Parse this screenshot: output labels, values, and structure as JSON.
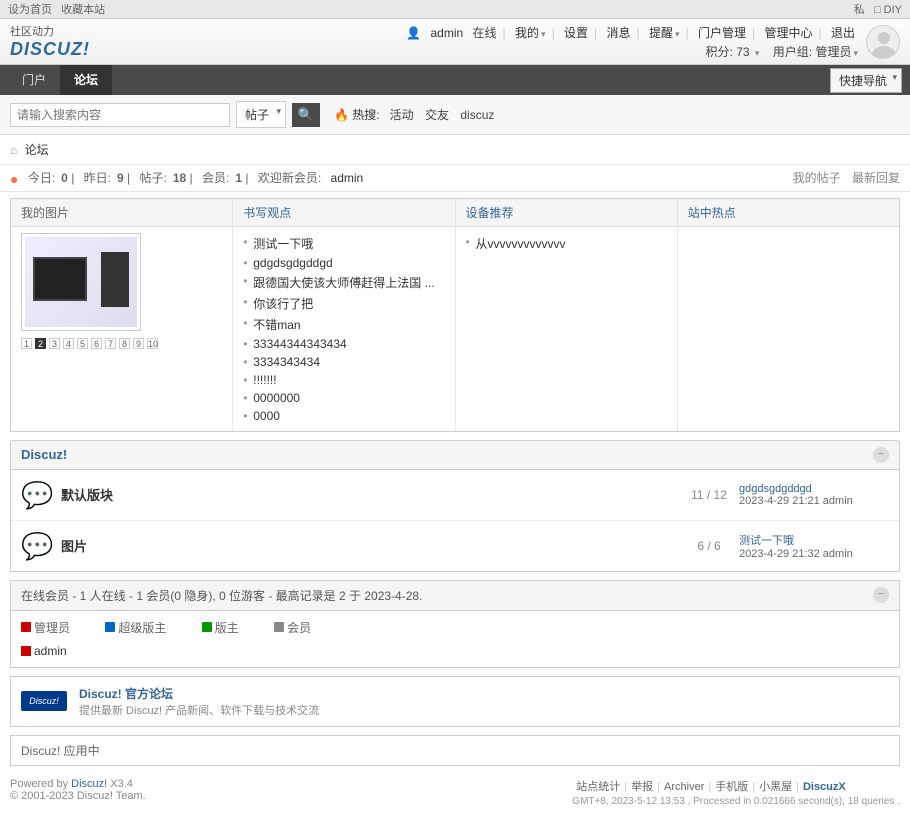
{
  "topStrip": {
    "left1": "设为首页",
    "left2": "收藏本站",
    "right1": "私",
    "right2": "□ DIY"
  },
  "header": {
    "slogan": "社区动力",
    "brand": "DISCUZ!",
    "user": {
      "name": "admin",
      "status": "在线",
      "my": "我的",
      "settings": "设置",
      "messages": "消息",
      "reminders": "提醒",
      "portal": "门户管理",
      "admin": "管理中心",
      "logout": "退出"
    },
    "row2": {
      "credits_label": "积分:",
      "credits": "73",
      "usergroup_label": "用户组:",
      "usergroup": "管理员"
    }
  },
  "nav": {
    "portal": "门户",
    "forum": "论坛",
    "quick": "快捷导航"
  },
  "search": {
    "placeholder": "请输入搜索内容",
    "scope": "帖子",
    "hot_label": "热搜:",
    "hot": [
      "活动",
      "交友",
      "discuz"
    ]
  },
  "crumb": {
    "home": "⌂",
    "forum": "论坛"
  },
  "stats": {
    "today_label": "今日:",
    "today": "0",
    "posts_label": "昨日:",
    "posts": "9",
    "threads_label": "帖子:",
    "threads": "18",
    "members_label": "会员:",
    "members": "1",
    "welcome_label": "欢迎新会员:",
    "newuser": "admin",
    "myposts": "我的帖子",
    "latest": "最新回复"
  },
  "tri": {
    "col1_title": "我的图片",
    "pager": [
      "1",
      "2",
      "3",
      "4",
      "5",
      "6",
      "7",
      "8",
      "9",
      "10"
    ],
    "col2_title": "书写观点",
    "posts": [
      "测试一下哦",
      "gdgdsgdgddgd",
      "跟德国大使该大师傅赶得上法国 ...",
      "你该行了把",
      "不错man",
      "33344344343434",
      "3334343434",
      "!!!!!!!",
      "0000000",
      "0000"
    ],
    "col3_title": "设备推荐",
    "recs": [
      "从vvvvvvvvvvvvv"
    ],
    "col4_title": "站中热点"
  },
  "cat": {
    "title": "Discuz!"
  },
  "forums": [
    {
      "name": "默认版块",
      "count": "11 / 12",
      "last_title": "gdgdsgdgddgd",
      "last_meta": "2023-4-29 21:21 admin"
    },
    {
      "name": "图片",
      "count": "6 / 6",
      "last_title": "测试一下哦",
      "last_meta": "2023-4-29 21:32 admin"
    }
  ],
  "online": {
    "summary": "在线会员 - 1 人在线 - 1 会员(0 隐身), 0 位游客 - 最高记录是 2 于 2023-4-28.",
    "legend": {
      "admin": "管理员",
      "smod": "超级版主",
      "mod": "版主",
      "member": "会员"
    },
    "user": "admin"
  },
  "link": {
    "title": "Discuz! 官方论坛",
    "desc": "提供最新 Discuz! 产品新闻、软件下载与技术交流",
    "logo": "Discuz!"
  },
  "app": {
    "title": "Discuz! 应用中"
  },
  "footer": {
    "powered": "Powered by ",
    "brand": "Discuz!",
    "ver": " X3.4",
    "copyright": "© 2001-2023 Discuz! Team.",
    "links": [
      "站点统计",
      "举报",
      "Archiver",
      "手机版",
      "小黑屋",
      "DiscuzX"
    ],
    "perf": "GMT+8, 2023-5-12 13:53 , Processed in 0.021666 second(s), 18 queries ."
  }
}
